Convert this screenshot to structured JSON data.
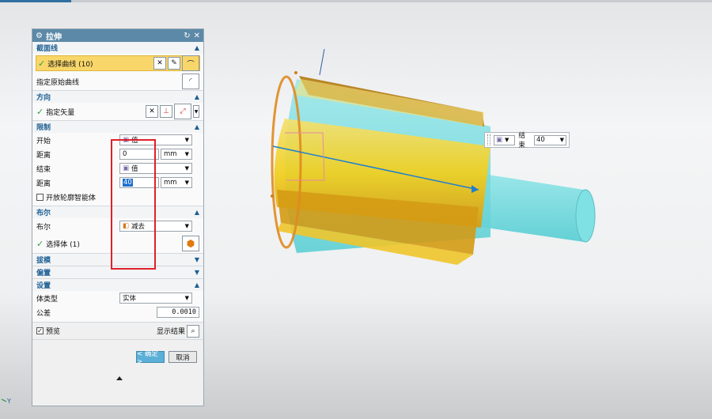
{
  "dialog": {
    "title": "拉伸",
    "section": {
      "label": "截面线",
      "select_curve": "选择曲线 (10)",
      "specify_origin_curve": "指定原始曲线"
    },
    "direction": {
      "label": "方向",
      "specify_vector": "指定矢量"
    },
    "limits": {
      "label": "限制",
      "start_label": "开始",
      "start_value": "值",
      "distance1_label": "距离",
      "distance1_value": "0",
      "unit1": "mm",
      "end_label": "结束",
      "end_value": "值",
      "distance2_label": "距离",
      "distance2_value": "40",
      "unit2": "mm",
      "open_profile": "开放轮廓智能体"
    },
    "boolean": {
      "label": "布尔",
      "bool_label": "布尔",
      "bool_value": "减去",
      "select_body": "选择体 (1)"
    },
    "draft": {
      "label": "拔模"
    },
    "offset": {
      "label": "偏置"
    },
    "settings": {
      "label": "设置",
      "body_type_label": "体类型",
      "body_type_value": "实体",
      "tolerance_label": "公差",
      "tolerance_value": "0.0010"
    },
    "preview_label": "预览",
    "show_result_label": "显示结果",
    "ok_label": "< 确定 >",
    "cancel_label": "取消"
  },
  "popup": {
    "end_label": "结束",
    "end_value": "40"
  },
  "axis_label": "Y",
  "colors": {
    "title_bar": "#5c89a8",
    "section_header_text": "#1d5f93",
    "selection_highlight": "#f8d66a",
    "callout_box": "#e0202a",
    "model_yellow": "#f2cf1c",
    "model_cyan": "#6fdde0"
  }
}
